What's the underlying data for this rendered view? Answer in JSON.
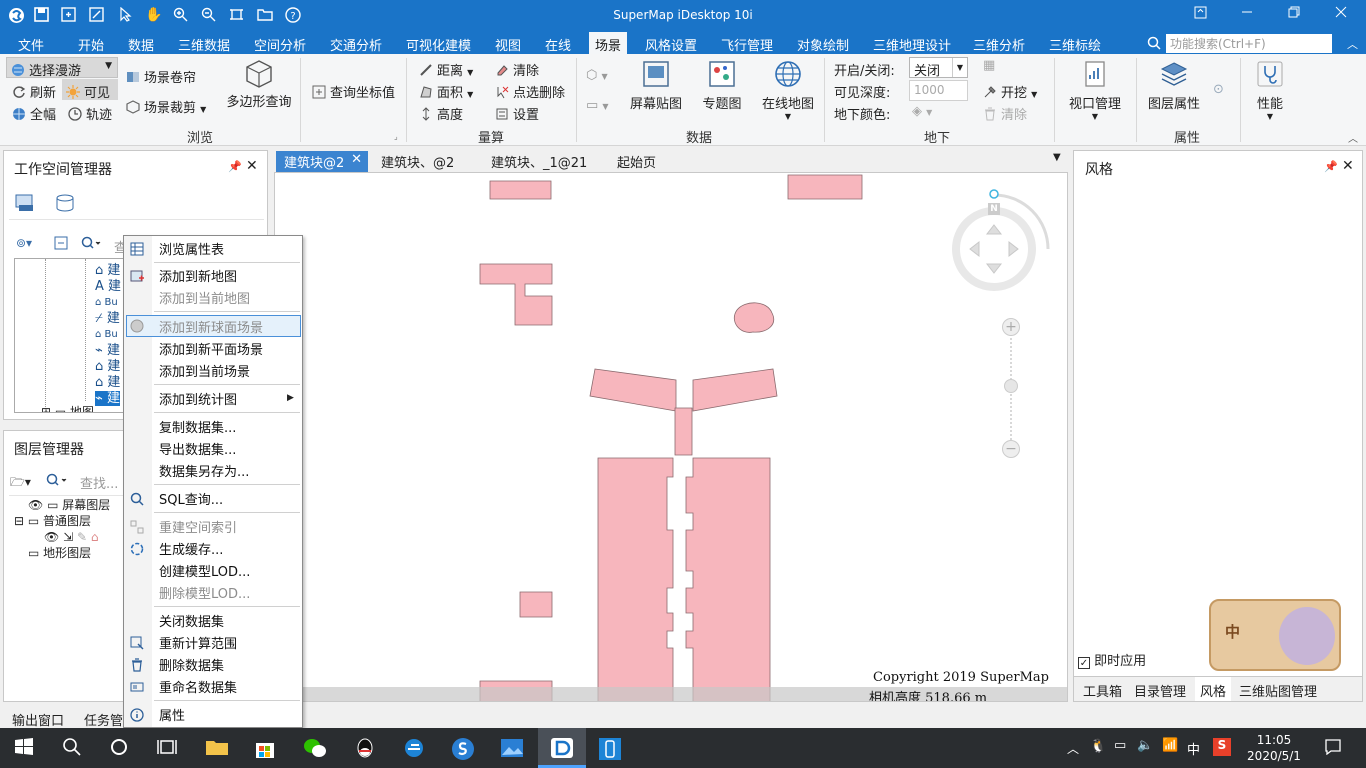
{
  "app": {
    "title": "SuperMap iDesktop 10i"
  },
  "menu": [
    "文件",
    "开始",
    "数据",
    "三维数据",
    "空间分析",
    "交通分析",
    "可视化建模",
    "视图",
    "在线",
    "场景",
    "风格设置",
    "飞行管理",
    "对象绘制",
    "三维地理设计",
    "三维分析",
    "三维标绘"
  ],
  "search": {
    "placeholder": "功能搜索(Ctrl+F)"
  },
  "ribbon": {
    "browse": {
      "select_roam": "选择漫游",
      "refresh": "刷新",
      "visible": "可见",
      "full": "全幅",
      "track": "轨迹",
      "scene_shutter": "场景卷帘",
      "scene_clip": "场景裁剪",
      "polygon_query": "多边形查询",
      "label": "浏览"
    },
    "query_coords": "查询坐标值",
    "measure": {
      "distance": "距离",
      "area": "面积",
      "height": "高度",
      "clear": "清除",
      "point_delete": "点选删除",
      "settings": "设置",
      "label": "量算"
    },
    "data": {
      "screen_map": "屏幕贴图",
      "thematic": "专题图",
      "online_map": "在线地图",
      "label": "数据"
    },
    "underground": {
      "on_off_label": "开启/关闭:",
      "on_off_value": "关闭",
      "depth_label": "可见深度:",
      "depth_value": "1000",
      "color_label": "地下颜色:",
      "dig": "开挖",
      "clear": "清除",
      "label": "地下"
    },
    "props": {
      "viewport": "视口管理",
      "layer_props": "图层属性",
      "performance": "性能",
      "label": "属性"
    }
  },
  "workspace": {
    "title": "工作空间管理器",
    "search_hint": "查",
    "map_node": "地图"
  },
  "layers": {
    "title": "图层管理器",
    "search_placeholder": "查找...",
    "items": [
      "屏幕图层",
      "普通图层",
      "地形图层"
    ]
  },
  "tabs": [
    "建筑块@2",
    "建筑块、@2",
    "建筑块、_1@21",
    "起始页"
  ],
  "scene": {
    "copyright": "Copyright 2019 SuperMap",
    "camera": "相机高度 518.66 m",
    "north": "N"
  },
  "style_panel": {
    "title": "风格",
    "instant_apply": "即时应用",
    "tabs": [
      "工具箱",
      "目录管理",
      "风格",
      "三维贴图管理"
    ]
  },
  "bottom_tabs": [
    "输出窗口",
    "任务管"
  ],
  "context_menu": [
    {
      "label": "浏览属性表",
      "disabled": false
    },
    {
      "label": "添加到新地图",
      "disabled": false
    },
    {
      "label": "添加到当前地图",
      "disabled": true
    },
    {
      "label": "添加到新球面场景",
      "disabled": true
    },
    {
      "label": "添加到新平面场景",
      "disabled": false
    },
    {
      "label": "添加到当前场景",
      "disabled": false
    },
    {
      "label": "添加到统计图",
      "disabled": false
    },
    {
      "label": "复制数据集...",
      "disabled": false
    },
    {
      "label": "导出数据集...",
      "disabled": false
    },
    {
      "label": "数据集另存为...",
      "disabled": false
    },
    {
      "label": "SQL查询...",
      "disabled": false
    },
    {
      "label": "重建空间索引",
      "disabled": true
    },
    {
      "label": "生成缓存...",
      "disabled": false
    },
    {
      "label": "创建模型LOD...",
      "disabled": false
    },
    {
      "label": "删除模型LOD...",
      "disabled": true
    },
    {
      "label": "关闭数据集",
      "disabled": false
    },
    {
      "label": "重新计算范围",
      "disabled": false
    },
    {
      "label": "删除数据集",
      "disabled": false
    },
    {
      "label": "重命名数据集",
      "disabled": false
    },
    {
      "label": "属性",
      "disabled": false
    }
  ],
  "taskbar": {
    "time": "11:05",
    "date": "2020/5/1",
    "ime": "中"
  },
  "colors": {
    "accent": "#1a74c8",
    "building": "#f7b6bd",
    "building_stroke": "#8a6a6e"
  }
}
